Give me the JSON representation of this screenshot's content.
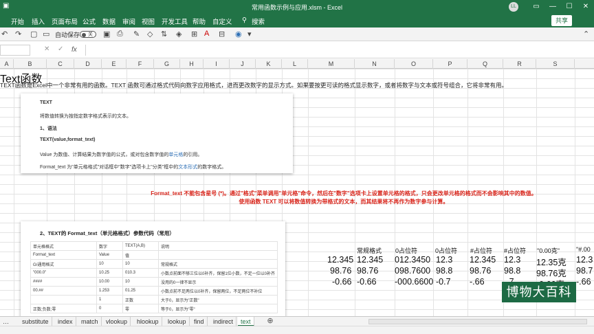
{
  "window": {
    "title": "常用函数示例与应用.xlsm  -  Excel",
    "user_initials": "LL"
  },
  "ribbon": {
    "tabs": [
      "开始",
      "插入",
      "页面布局",
      "公式",
      "数据",
      "审阅",
      "视图",
      "开发工具",
      "帮助",
      "自定义"
    ],
    "search": "搜索",
    "share": "共享"
  },
  "quick_toolbar": {
    "autosave_label": "自动保存",
    "autosave_state": "关"
  },
  "formula_bar": {
    "fx_label": "fx",
    "value": ""
  },
  "columns": [
    "A",
    "B",
    "C",
    "D",
    "E",
    "F",
    "G",
    "H",
    "I",
    "J",
    "K",
    "L",
    "M",
    "N",
    "O",
    "P",
    "Q",
    "R",
    "S"
  ],
  "sheet": {
    "title": "Text函数",
    "description": "TEXT函数是Excel中一个非常有用的函数。TEXT 函数可通过格式代码向数字应用格式，进而更改数字的显示方式。如果要按更可读的格式显示数字，或者将数字与文本或符号组合，它将非常有用。"
  },
  "box1": {
    "heading": "TEXT",
    "line1": "将数值转换为按指定数字格式表示的文本。",
    "section": "1、语法",
    "syntax": "TEXT(value,format_text)",
    "value_desc_pre": "Value 为数值、计算结果为数字值的公式，或对包含数字值的",
    "value_desc_link": "单元格",
    "value_desc_post": "的引用。",
    "format_desc_pre": "Format_text 为\"单元格格式\"对话框中\"数字\"选项卡上\"分类\"框中的",
    "format_desc_link": "文本形式",
    "format_desc_post": "的数字格式。"
  },
  "red_note": {
    "line1": "Format_text 不能包含星号 (*)。通过\"格式\"菜单调用\"单元格\"命令，然后在\"数字\"选项卡上设置单元格的格式，只会更改单元格的格式而不会影响其中的数值。",
    "line2": "使用函数 TEXT 可以将数值转换为带格式的文本，而其结果将不再作为数字参与计算。"
  },
  "box2": {
    "heading": "2、TEXT的 Format_text（单元格格式）参数代码（常用）",
    "rows": [
      [
        "单元格格式",
        "数字",
        "TEXT(A,B)",
        "说明"
      ],
      [
        "Format_text",
        "Value",
        "值",
        ""
      ],
      [
        "G/通用格式",
        "10",
        "10",
        "常规格式"
      ],
      [
        "\"000.0\"",
        "10.25",
        "010.3",
        "小数点前面不够三位以0补齐，保留1位小数，不足一位以0补齐"
      ],
      [
        "####",
        "10.00",
        "10",
        "没用的0一律不显示"
      ],
      [
        "00.##",
        "1.253",
        "01.25",
        "小数点前不足两位以0补齐，保留两位，不足两位不补位"
      ],
      [
        "",
        "1",
        "正数",
        "大于0，显示为\"正数\""
      ],
      [
        "正数;负数;零",
        "0",
        "零",
        "等于0，显示为\"零\""
      ]
    ]
  },
  "data_table": {
    "headers": [
      "常规格式",
      "0占位符",
      "0占位符",
      "#占位符",
      "#占位符",
      "\"0.00克\"",
      "\"#.00"
    ],
    "source_values": [
      "12.345",
      "98.76",
      "-0.66"
    ],
    "rows": [
      [
        "12.345",
        "012.3450",
        "12.3",
        "12.345",
        "12.3",
        "12.35克",
        "12.3"
      ],
      [
        "98.76",
        "098.7600",
        "98.8",
        "98.76",
        "98.8",
        "98.76克",
        "98.7"
      ],
      [
        "-0.66",
        "-000.6600",
        "-0.7",
        "-.66",
        "-.7",
        "-0.66克",
        "-.66"
      ]
    ]
  },
  "watermark": "博物大百科",
  "sheet_tabs": [
    "substitute",
    "index",
    "match",
    "vlookup",
    "hlookup",
    "lookup",
    "find",
    "indirect",
    "text"
  ],
  "active_sheet": "text"
}
